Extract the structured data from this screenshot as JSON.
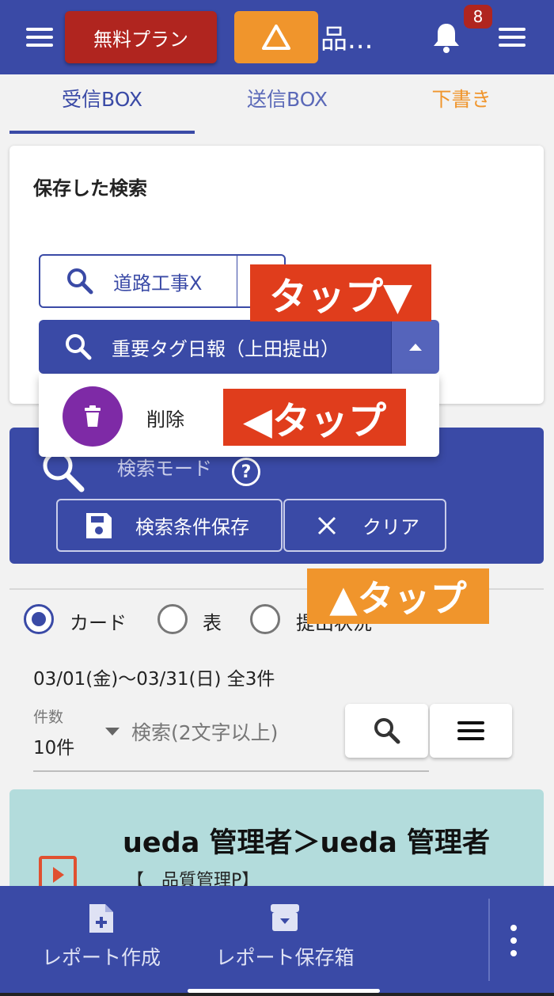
{
  "header": {
    "plan_button": "無料プラン",
    "title": "品...",
    "notification_count": "8",
    "warning_icon": "triangle-warning-icon",
    "bell_icon": "bell-icon"
  },
  "tabs": [
    {
      "label": "受信BOX",
      "color": "#3a4aa6",
      "active": true
    },
    {
      "label": "送信BOX",
      "color": "#5b69b8",
      "active": false
    },
    {
      "label": "下書き",
      "color": "#f0952c",
      "active": false
    }
  ],
  "saved_search": {
    "title": "保存した検索",
    "items": [
      {
        "label": "道路工事X",
        "selected": false
      },
      {
        "label": "重要タグ日報（上田提出）",
        "selected": true
      }
    ],
    "menu": {
      "delete_label": "削除"
    }
  },
  "callouts": {
    "tap_down": "タップ▼",
    "tap_left": "◀タップ",
    "tap_up": "▲タップ"
  },
  "search_mode": {
    "label": "検索モード",
    "help": "?",
    "save_button": "検索条件保存",
    "clear_button": "クリア"
  },
  "view_options": {
    "options": [
      "カード",
      "表",
      "提出状況"
    ],
    "selected": "カード"
  },
  "date_range": "03/01(金)〜03/31(日) 全3件",
  "count": {
    "label": "件数",
    "value": "10件"
  },
  "keyword": {
    "placeholder": "検索(2文字以上)"
  },
  "report": {
    "title": "ueda 管理者＞ueda 管理者",
    "subtitle": "【　品質管理P】"
  },
  "bottom_nav": {
    "create": "レポート作成",
    "storage": "レポート保存箱"
  },
  "colors": {
    "primary": "#3a4aa6",
    "danger": "#b0251f",
    "accent_orange": "#f0952c",
    "callout_red": "#e03d1c",
    "delete_purple": "#7e2aa6",
    "report_card": "#b3dcdc"
  }
}
